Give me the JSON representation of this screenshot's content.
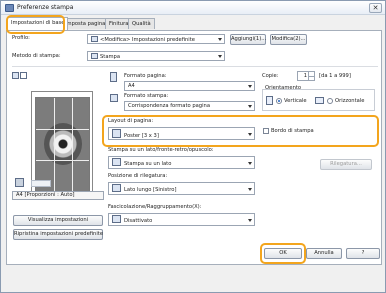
{
  "window": {
    "title": "Preferenze stampa"
  },
  "tabs": [
    {
      "label": "Impostazioni di base"
    },
    {
      "label": "Imposta pagina"
    },
    {
      "label": "Finitura"
    },
    {
      "label": "Qualità"
    }
  ],
  "profile": {
    "label": "Profilo:",
    "value": "<Modifica> Impostazioni predefinite",
    "add_button": "Aggiungi(1)...",
    "edit_button": "Modifica(2)..."
  },
  "output_method": {
    "label": "Metodo di stampa:",
    "value": "Stampa"
  },
  "page_size": {
    "label": "Formato pagina:",
    "value": "A4"
  },
  "output_size": {
    "label": "Formato stampa:",
    "value": "Corrispondenza formato pagina"
  },
  "copies": {
    "label": "Copie:",
    "value": "1",
    "range": "[da 1 a 999]"
  },
  "orientation": {
    "label": "Orientamento",
    "portrait": "Verticale",
    "landscape": "Orizzontale",
    "selected": "portrait"
  },
  "page_layout": {
    "label": "Layout di pagina:",
    "value": "Poster [3 x 3]",
    "page_border_label": "Bordo di stampa"
  },
  "duplex": {
    "label": "Stampa su un lato/fronte-retro/opuscolo:",
    "value": "Stampa su un lato"
  },
  "binding": {
    "label": "Posizione di rilegatura:",
    "value": "Lato lungo [Sinistro]",
    "button": "Rilegatura..."
  },
  "collate": {
    "label": "Fascicolazione/Raggruppamento(X):",
    "value": "Disattivato"
  },
  "preview": {
    "status": "A4 [Proporzioni : Auto]"
  },
  "left_buttons": {
    "view_settings": "Visualizza impostazioni",
    "restore_defaults": "Ripristina impostazioni predefinite"
  },
  "footer": {
    "ok": "OK",
    "cancel": "Annulla",
    "help": "?"
  },
  "colors": {
    "highlight": "#f3a51d",
    "accent": "#1e5fbf"
  }
}
